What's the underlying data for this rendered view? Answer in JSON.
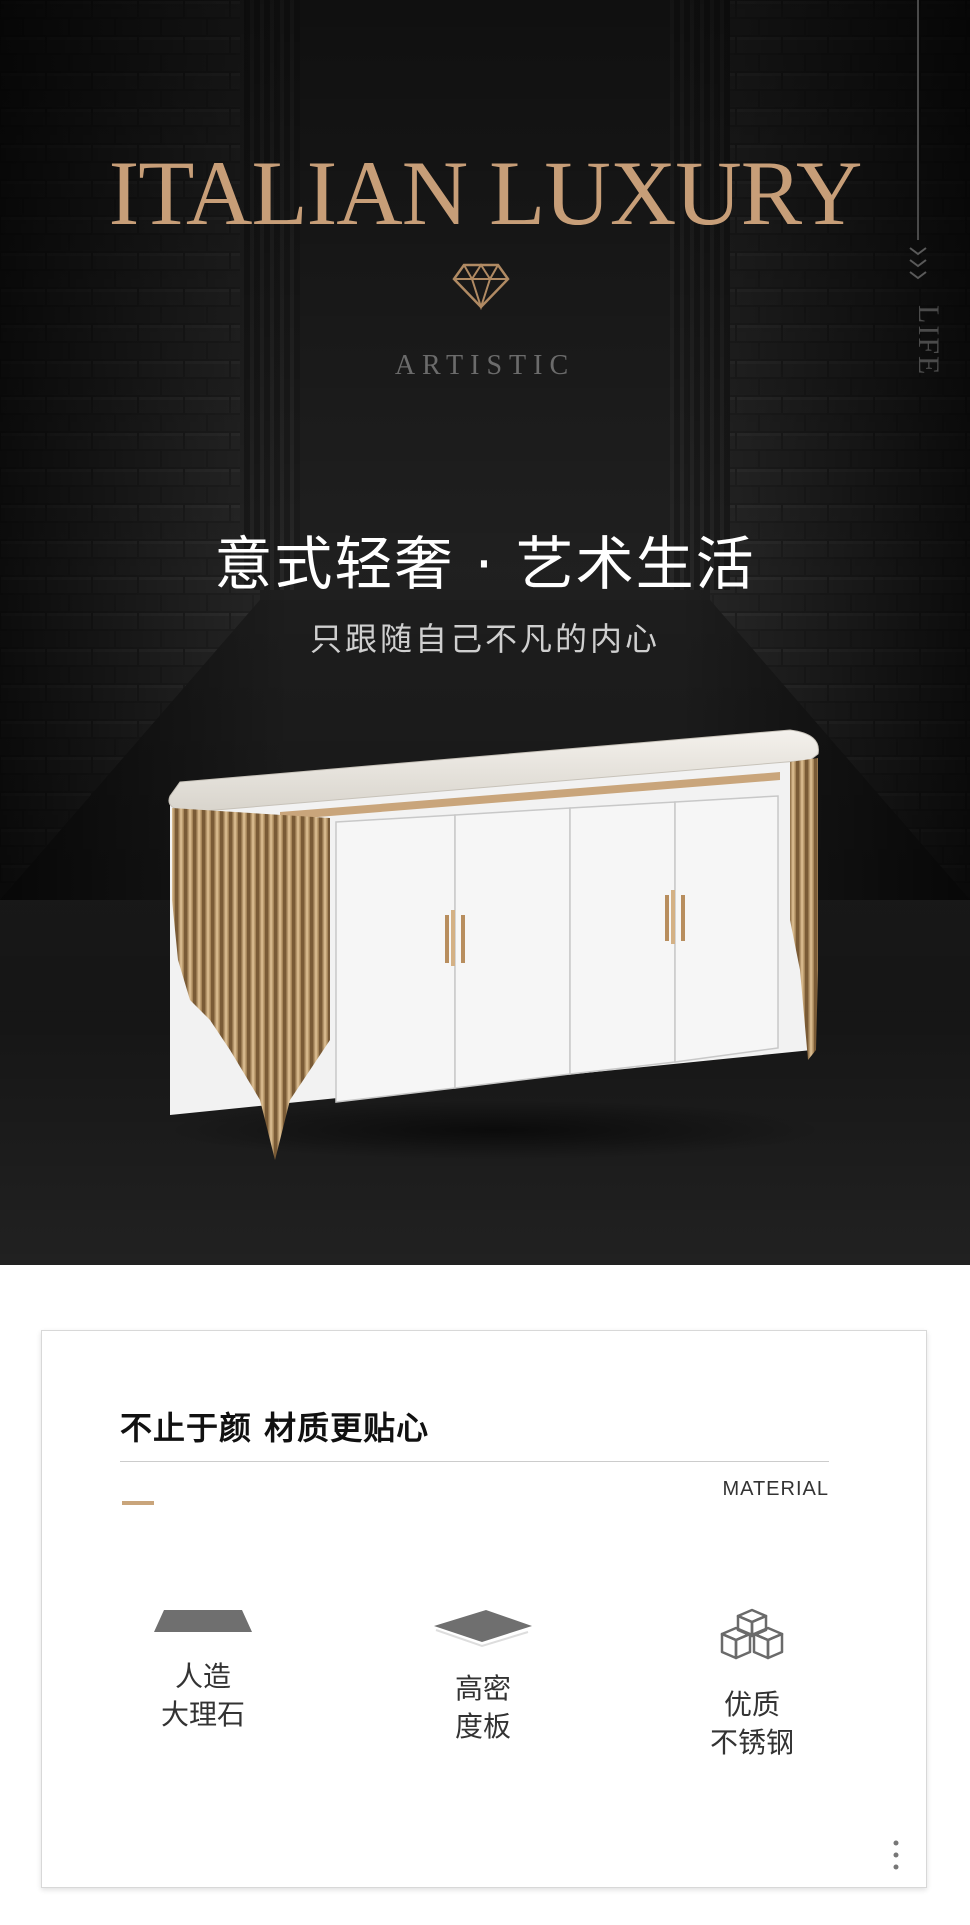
{
  "hero": {
    "title": "ITALIAN LUXURY",
    "subtitle": "ARTISTIC",
    "side_label": "LIFE",
    "headline": "意式轻奢 · 艺术生活",
    "tagline": "只跟随自己不凡的内心",
    "gem_icon": "diamond-icon",
    "accent_color": "#c79e78"
  },
  "material": {
    "title": "不止于颜 材质更贴心",
    "subtitle_en": "MATERIAL",
    "accent_color": "#c9a57b",
    "features": [
      {
        "icon": "marble-slab-icon",
        "line1": "人造",
        "line2": "大理石"
      },
      {
        "icon": "board-icon",
        "line1": "高密",
        "line2": "度板"
      },
      {
        "icon": "cubes-icon",
        "line1": "优质",
        "line2": "不锈钢"
      }
    ]
  }
}
